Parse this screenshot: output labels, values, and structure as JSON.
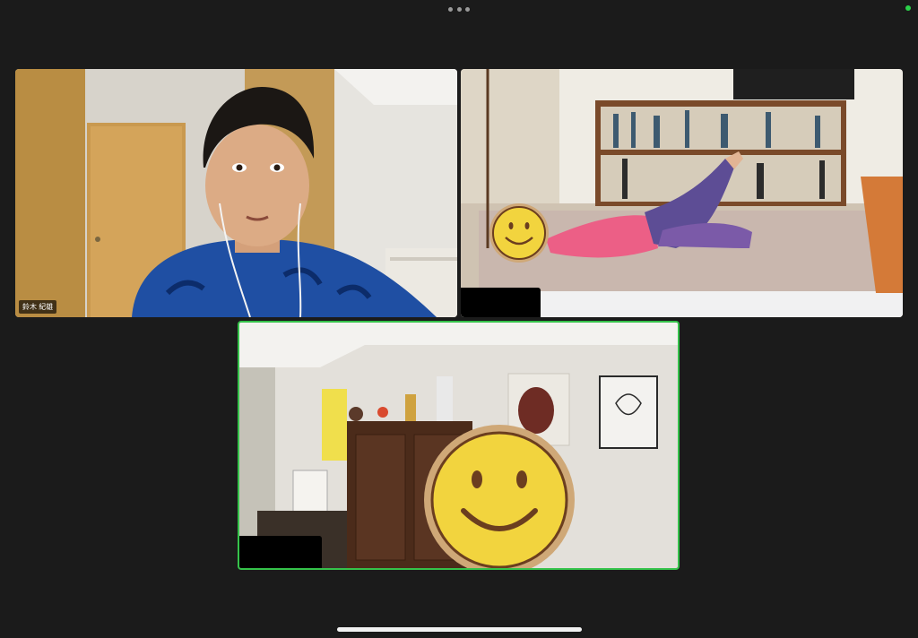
{
  "header": {
    "more_icon": "more-dots-icon",
    "status_dot_color": "#2bd24a"
  },
  "participants": [
    {
      "name": "鈴木 紀雄",
      "speaking": false
    },
    {
      "name": "",
      "speaking": false,
      "avatar": "smiley-face"
    },
    {
      "name": "",
      "speaking": true,
      "avatar": "smiley-face"
    }
  ],
  "colors": {
    "active_border": "#35c24a",
    "background": "#1b1b1b"
  }
}
